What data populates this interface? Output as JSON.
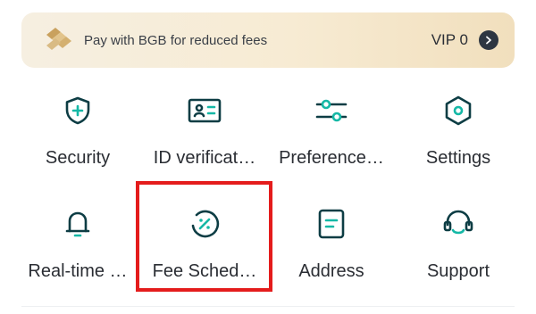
{
  "banner": {
    "text": "Pay with BGB for reduced fees",
    "vip_label": "VIP 0"
  },
  "menu": {
    "items": [
      {
        "label": "Security",
        "icon": "shield-plus-icon"
      },
      {
        "label": "ID verificat…",
        "icon": "id-card-icon"
      },
      {
        "label": "Preference…",
        "icon": "sliders-icon"
      },
      {
        "label": "Settings",
        "icon": "hexagon-settings-icon"
      },
      {
        "label": "Real-time …",
        "icon": "bell-icon"
      },
      {
        "label": "Fee Sched…",
        "icon": "percent-circle-icon"
      },
      {
        "label": "Address",
        "icon": "document-icon"
      },
      {
        "label": "Support",
        "icon": "headset-icon"
      }
    ]
  },
  "colors": {
    "icon_teal": "#0d3d44",
    "highlight_red": "#e41c1c",
    "banner_gold": "#f3e4c6"
  }
}
